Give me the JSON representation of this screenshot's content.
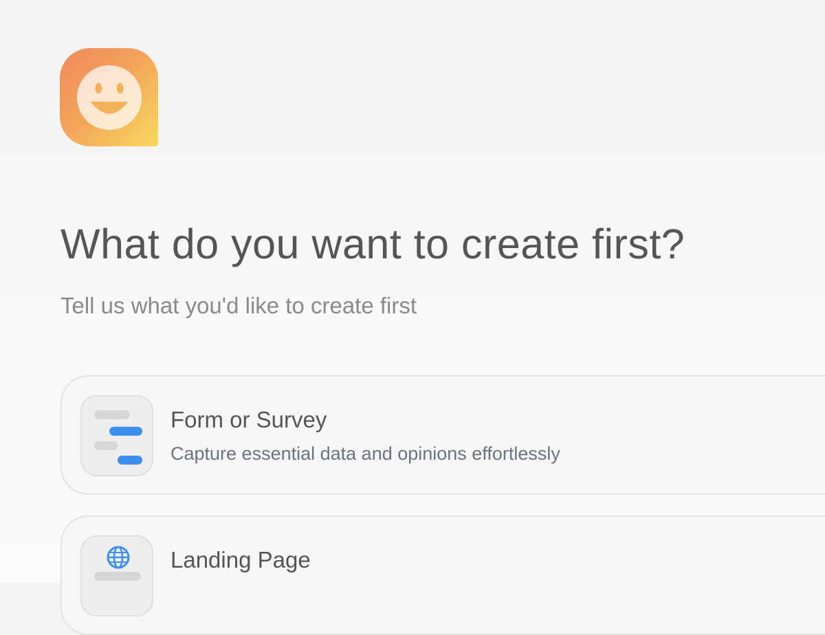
{
  "logo": {
    "icon": "smiley-face-icon",
    "gradient": [
      "#f0885c",
      "#f8d85e"
    ]
  },
  "header": {
    "title": "What do you want to create first?",
    "subtitle": "Tell us what you'd like to create first"
  },
  "options": [
    {
      "title": "Form or Survey",
      "description": "Capture essential data and opinions effortlessly",
      "icon": "form-survey-icon"
    },
    {
      "title": "Landing Page",
      "description": "",
      "icon": "globe-icon"
    }
  ],
  "colors": {
    "accent": "#3d8fef",
    "title_text": "#555555",
    "subtitle_text": "#8a8a8a",
    "description_text": "#6c7380"
  }
}
